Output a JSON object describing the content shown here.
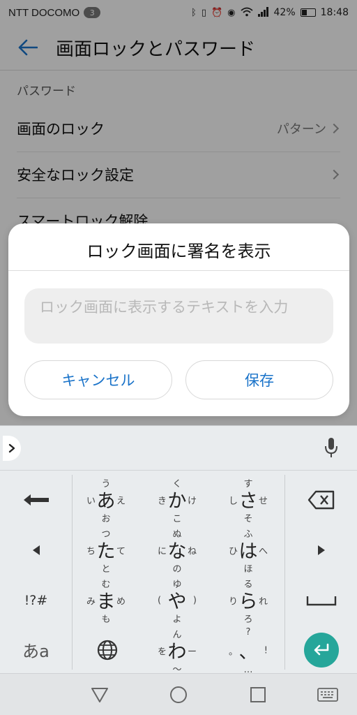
{
  "status_bar": {
    "carrier": "NTT DOCOMO",
    "sim_badge": "3",
    "battery_percent": "42%",
    "battery_level": 0.42,
    "time": "18:48"
  },
  "app_bar": {
    "title": "画面ロックとパスワード"
  },
  "settings": {
    "section_header": "パスワード",
    "rows": [
      {
        "label": "画面のロック",
        "value": "パターン"
      },
      {
        "label": "安全なロック設定",
        "value": ""
      },
      {
        "label": "スマートロック解除",
        "value": ""
      }
    ]
  },
  "dialog": {
    "title": "ロック画面に署名を表示",
    "input_placeholder": "ロック画面に表示するテキストを入力",
    "cancel_label": "キャンセル",
    "save_label": "保存"
  },
  "keyboard": {
    "keys": {
      "a": {
        "center": "あ",
        "up": "う",
        "left": "い",
        "right": "え",
        "down": "お"
      },
      "ka": {
        "center": "か",
        "up": "く",
        "left": "き",
        "right": "け",
        "down": "こ"
      },
      "sa": {
        "center": "さ",
        "up": "す",
        "left": "し",
        "right": "せ",
        "down": "そ"
      },
      "ta": {
        "center": "た",
        "up": "つ",
        "left": "ち",
        "right": "て",
        "down": "と"
      },
      "na": {
        "center": "な",
        "up": "ぬ",
        "left": "に",
        "right": "ね",
        "down": "の"
      },
      "ha": {
        "center": "は",
        "up": "ふ",
        "left": "ひ",
        "right": "へ",
        "down": "ほ"
      },
      "ma": {
        "center": "ま",
        "up": "む",
        "left": "み",
        "right": "め",
        "down": "も"
      },
      "ya": {
        "center": "や",
        "up": "ゆ",
        "left": "(",
        "right": ")",
        "down": "よ"
      },
      "ra": {
        "center": "ら",
        "up": "る",
        "left": "り",
        "right": "れ",
        "down": "ろ"
      },
      "wa": {
        "center": "わ",
        "up": "ん",
        "left": "を",
        "right": "ー",
        "down": "〜"
      },
      "punct": {
        "center": "、",
        "up": "?",
        "left": "。",
        "right": "!",
        "down": "…"
      }
    },
    "symbols_label": "!?#",
    "mode_label": "あa"
  }
}
